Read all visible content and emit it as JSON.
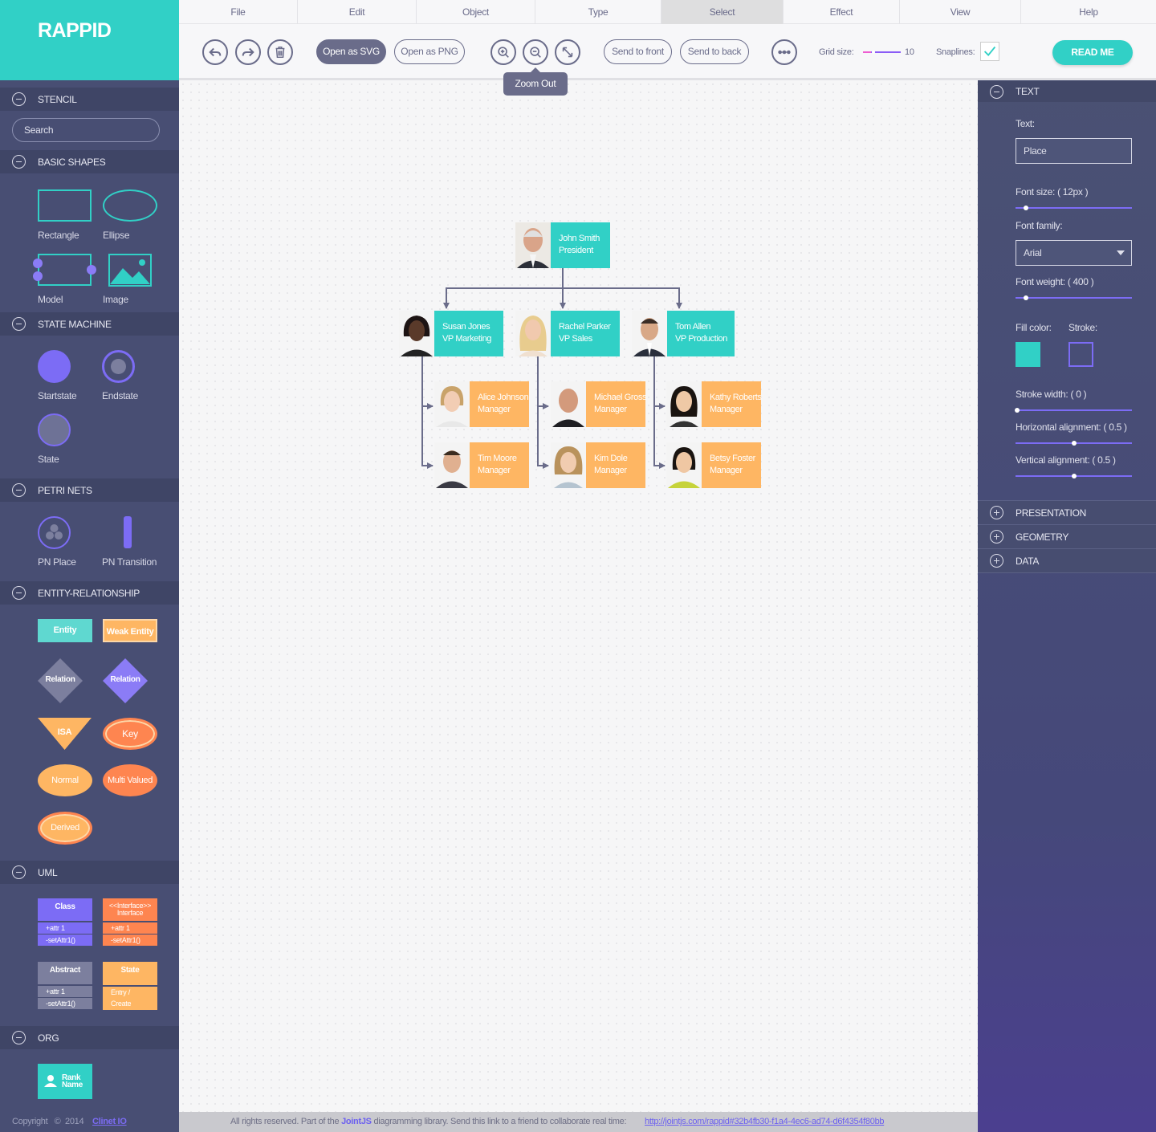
{
  "app": {
    "logo": "RAPPID"
  },
  "menu": [
    "File",
    "Edit",
    "Object",
    "Type",
    "Select",
    "Effect",
    "View",
    "Help"
  ],
  "menu_active": "Select",
  "toolbar": {
    "open_svg": "Open as SVG",
    "open_png": "Open as PNG",
    "send_front": "Send to front",
    "send_back": "Send to back",
    "grid_size_label": "Grid size:",
    "grid_size_value": "10",
    "snaplines_label": "Snaplines:",
    "snaplines_checked": true,
    "read_me": "READ ME",
    "tooltip": "Zoom Out"
  },
  "stencil": {
    "title": "STENCIL",
    "search_placeholder": "Search",
    "sections": {
      "basic": "BASIC SHAPES",
      "state": "STATE MACHINE",
      "petri": "PETRI NETS",
      "er": "ENTITY-RELATIONSHIP",
      "uml": "UML",
      "org": "ORG"
    },
    "basic_items": [
      "Rectangle",
      "Ellipse",
      "Model",
      "Image"
    ],
    "state_items": [
      "Startstate",
      "Endstate",
      "State"
    ],
    "petri_items": [
      "PN Place",
      "PN Transition"
    ],
    "er_items": {
      "entity": "Entity",
      "weak_entity": "Weak Entity",
      "relation1": "Relation",
      "relation2": "Relation",
      "isa": "ISA",
      "key": "Key",
      "normal": "Normal",
      "multi": "Multi Valued",
      "derived": "Derived"
    },
    "uml_items": {
      "class": {
        "title": "Class",
        "attr": "+attr 1",
        "method": "-setAttr1()"
      },
      "interface": {
        "stereo": "<<Interface>>",
        "title": "Interface",
        "attr": "+attr 1",
        "method": "-setAttr1()"
      },
      "abstract": {
        "title": "Abstract",
        "attr": "+attr 1",
        "method": "-setAttr1()"
      },
      "state": {
        "title": "State",
        "line1": "Entry /",
        "line2": "Create"
      }
    },
    "org_item": {
      "line1": "Rank",
      "line2": "Name"
    }
  },
  "org_chart": {
    "president": {
      "name": "John Smith",
      "role": "President"
    },
    "vps": [
      {
        "name": "Susan Jones",
        "role": "VP Marketing"
      },
      {
        "name": "Rachel Parker",
        "role": "VP Sales"
      },
      {
        "name": "Tom Allen",
        "role": "VP Production"
      }
    ],
    "managers": [
      {
        "name": "Alice Johnson",
        "role": "Manager"
      },
      {
        "name": "Michael Gross",
        "role": "Manager"
      },
      {
        "name": "Kathy Roberts",
        "role": "Manager"
      },
      {
        "name": "Tim Moore",
        "role": "Manager"
      },
      {
        "name": "Kim Dole",
        "role": "Manager"
      },
      {
        "name": "Betsy Foster",
        "role": "Manager"
      }
    ]
  },
  "inspector": {
    "text_section": "TEXT",
    "text_label": "Text:",
    "text_value": "Place",
    "font_size_label": "Font size:",
    "font_size_value": "( 12px )",
    "font_family_label": "Font family:",
    "font_family_value": "Arial",
    "font_weight_label": "Font weight:",
    "font_weight_value": "( 400 )",
    "fill_label": "Fill color:",
    "stroke_label": "Stroke:",
    "stroke_width_label": "Stroke width:",
    "stroke_width_value": "( 0 )",
    "halign_label": "Horizontal alignment:",
    "halign_value": "( 0.5 )",
    "valign_label": "Vertical alignment:",
    "valign_value": "( 0.5 )",
    "sections": [
      "PRESENTATION",
      "GEOMETRY",
      "DATA"
    ],
    "fill_color": "#31d0c6",
    "stroke_color": "#7c6cf5"
  },
  "footer": {
    "copyright": "Copyright",
    "c_symbol": "©",
    "year": "2014",
    "company": "Clinet IO",
    "rights_text": "All rights reserved. Part of the",
    "brand": "JointJS",
    "rest_text": "diagramming library.  Send this link to a friend to collaborate real time:",
    "url": "http://jointjs.com/rappid#32b4fb30-f1a4-4ec6-ad74-d6f4354f80bb"
  }
}
